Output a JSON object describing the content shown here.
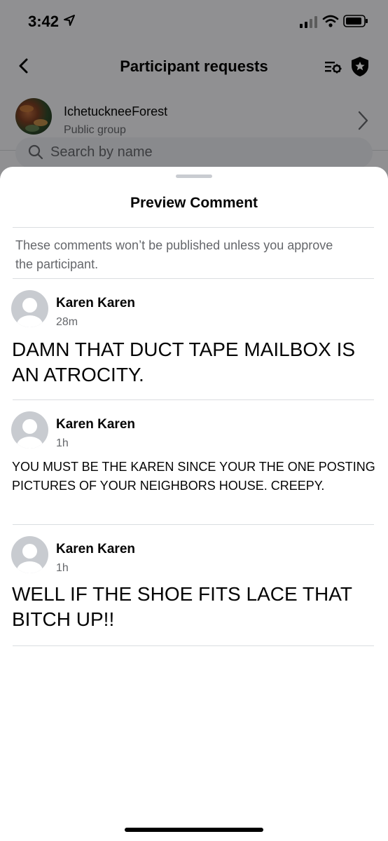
{
  "status_bar": {
    "time": "3:42"
  },
  "nav": {
    "title": "Participant requests"
  },
  "group": {
    "name": "IchetuckneeForest",
    "subtitle": "Public group"
  },
  "search": {
    "placeholder": "Search by name"
  },
  "sheet": {
    "title": "Preview Comment",
    "notice": "These comments won’t be published unless you approve the participant."
  },
  "comments": [
    {
      "author": "Karen Karen",
      "time": "28m",
      "text": "DAMN THAT DUCT TAPE MAILBOX IS AN ATROCITY."
    },
    {
      "author": "Karen Karen",
      "time": "1h",
      "text": "YOU MUST BE THE KAREN SINCE YOUR THE ONE POSTING PICTURES OF YOUR NEIGHBORS HOUSE. CREEPY."
    },
    {
      "author": "Karen Karen",
      "time": "1h",
      "text": "WELL IF THE SHOE FITS LACE THAT BITCH UP!!"
    }
  ]
}
